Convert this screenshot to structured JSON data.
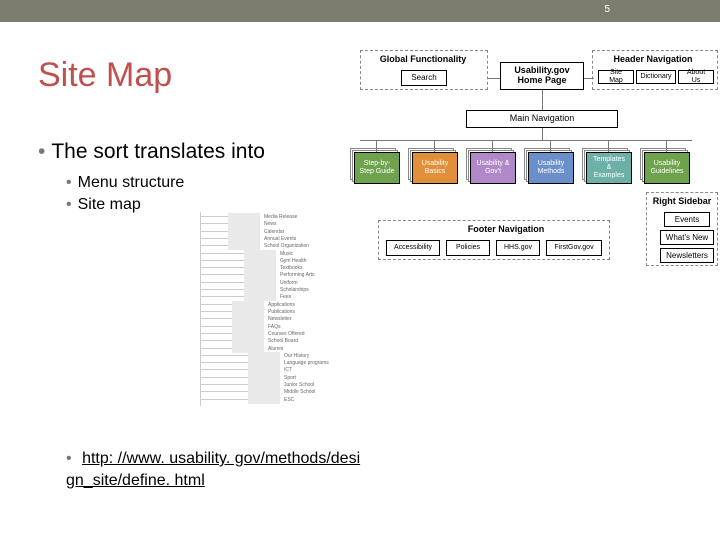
{
  "slide": {
    "page_number": "5",
    "title": "Site Map",
    "bullet_main": "The sort translates into",
    "sub_bullets": [
      "Menu structure",
      "Site map"
    ],
    "link_text": "http: //www. usability. gov/methods/design_site/define. html",
    "link_href": "http://www.usability.gov/methods/design_site/define.html"
  },
  "diagram": {
    "groups": {
      "global": {
        "label": "Global Functionality",
        "boxes": [
          "Search"
        ]
      },
      "home": {
        "label": "Usability.gov Home Page"
      },
      "header": {
        "label": "Header Navigation",
        "boxes": [
          "Site Map",
          "Dictionary",
          "About Us"
        ]
      },
      "main": {
        "label": "Main Navigation",
        "items": [
          "Step-by-Step Guide",
          "Usability Basics",
          "Usability & Gov't",
          "Usability Methods",
          "Templates & Examples",
          "Usability Guidelines"
        ]
      },
      "footer": {
        "label": "Footer Navigation",
        "boxes": [
          "Accessibility",
          "Policies",
          "HHS.gov",
          "FirstGov.gov"
        ]
      },
      "sidebar": {
        "label": "Right Sidebar",
        "boxes": [
          "Events",
          "What's New",
          "Newsletters"
        ]
      }
    }
  },
  "tree": {
    "items": [
      "Media Release",
      "News",
      "Calendar",
      "Annual Events",
      "School Organization",
      "Music",
      "Gym Health",
      "Textbooks",
      "Performing Arts",
      "Uniform",
      "Scholarships",
      "Fees",
      "Applications",
      "Publications",
      "Newsletter",
      "FAQs",
      "Courses Offered",
      "School Board",
      "Alumni",
      "Our History",
      "Language programs",
      "ICT",
      "Sport",
      "Junior School",
      "Middle School",
      "ESC"
    ]
  }
}
